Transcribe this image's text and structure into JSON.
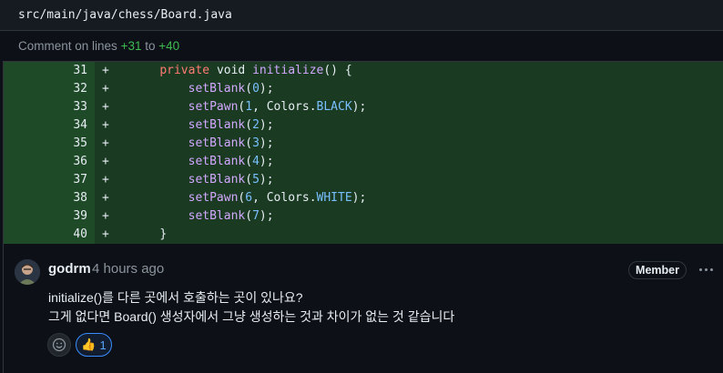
{
  "file": {
    "path": "src/main/java/chess/Board.java"
  },
  "comment_range": {
    "prefix": "Comment on lines ",
    "from": "+31",
    "to_word": " to ",
    "to": "+40"
  },
  "diff_lines": [
    {
      "num": "31",
      "marker": "+",
      "indent": "    ",
      "tokens": [
        {
          "t": "kw",
          "v": "private"
        },
        {
          "t": "p",
          "v": " "
        },
        {
          "t": "p",
          "v": "void"
        },
        {
          "t": "p",
          "v": " "
        },
        {
          "t": "fn",
          "v": "initialize"
        },
        {
          "t": "p",
          "v": "() {"
        }
      ]
    },
    {
      "num": "32",
      "marker": "+",
      "indent": "        ",
      "tokens": [
        {
          "t": "fn",
          "v": "setBlank"
        },
        {
          "t": "p",
          "v": "("
        },
        {
          "t": "num",
          "v": "0"
        },
        {
          "t": "p",
          "v": ");"
        }
      ]
    },
    {
      "num": "33",
      "marker": "+",
      "indent": "        ",
      "tokens": [
        {
          "t": "fn",
          "v": "setPawn"
        },
        {
          "t": "p",
          "v": "("
        },
        {
          "t": "num",
          "v": "1"
        },
        {
          "t": "p",
          "v": ", Colors."
        },
        {
          "t": "const",
          "v": "BLACK"
        },
        {
          "t": "p",
          "v": ");"
        }
      ]
    },
    {
      "num": "34",
      "marker": "+",
      "indent": "        ",
      "tokens": [
        {
          "t": "fn",
          "v": "setBlank"
        },
        {
          "t": "p",
          "v": "("
        },
        {
          "t": "num",
          "v": "2"
        },
        {
          "t": "p",
          "v": ");"
        }
      ]
    },
    {
      "num": "35",
      "marker": "+",
      "indent": "        ",
      "tokens": [
        {
          "t": "fn",
          "v": "setBlank"
        },
        {
          "t": "p",
          "v": "("
        },
        {
          "t": "num",
          "v": "3"
        },
        {
          "t": "p",
          "v": ");"
        }
      ]
    },
    {
      "num": "36",
      "marker": "+",
      "indent": "        ",
      "tokens": [
        {
          "t": "fn",
          "v": "setBlank"
        },
        {
          "t": "p",
          "v": "("
        },
        {
          "t": "num",
          "v": "4"
        },
        {
          "t": "p",
          "v": ");"
        }
      ]
    },
    {
      "num": "37",
      "marker": "+",
      "indent": "        ",
      "tokens": [
        {
          "t": "fn",
          "v": "setBlank"
        },
        {
          "t": "p",
          "v": "("
        },
        {
          "t": "num",
          "v": "5"
        },
        {
          "t": "p",
          "v": ");"
        }
      ]
    },
    {
      "num": "38",
      "marker": "+",
      "indent": "        ",
      "tokens": [
        {
          "t": "fn",
          "v": "setPawn"
        },
        {
          "t": "p",
          "v": "("
        },
        {
          "t": "num",
          "v": "6"
        },
        {
          "t": "p",
          "v": ", Colors."
        },
        {
          "t": "const",
          "v": "WHITE"
        },
        {
          "t": "p",
          "v": ");"
        }
      ]
    },
    {
      "num": "39",
      "marker": "+",
      "indent": "        ",
      "tokens": [
        {
          "t": "fn",
          "v": "setBlank"
        },
        {
          "t": "p",
          "v": "("
        },
        {
          "t": "num",
          "v": "7"
        },
        {
          "t": "p",
          "v": ");"
        }
      ]
    },
    {
      "num": "40",
      "marker": "+",
      "indent": "    ",
      "tokens": [
        {
          "t": "p",
          "v": "}"
        }
      ]
    }
  ],
  "comment": {
    "author": "godrm",
    "time": "4 hours ago",
    "badge": "Member",
    "body": [
      "initialize()를 다른 곳에서 호출하는 곳이 있나요?",
      "그게 없다면 Board() 생성자에서 그냥 생성하는 것과 차이가 없는 것 같습니다"
    ],
    "reaction": {
      "icon": "thumbs-up-icon",
      "count": "1"
    }
  },
  "colors": {
    "bg": "#0d1117",
    "added_line_bg": "#1a3a22",
    "added_num_bg": "#1f4a28",
    "accent_green": "#3fb950",
    "accent_blue": "#58a6ff"
  }
}
